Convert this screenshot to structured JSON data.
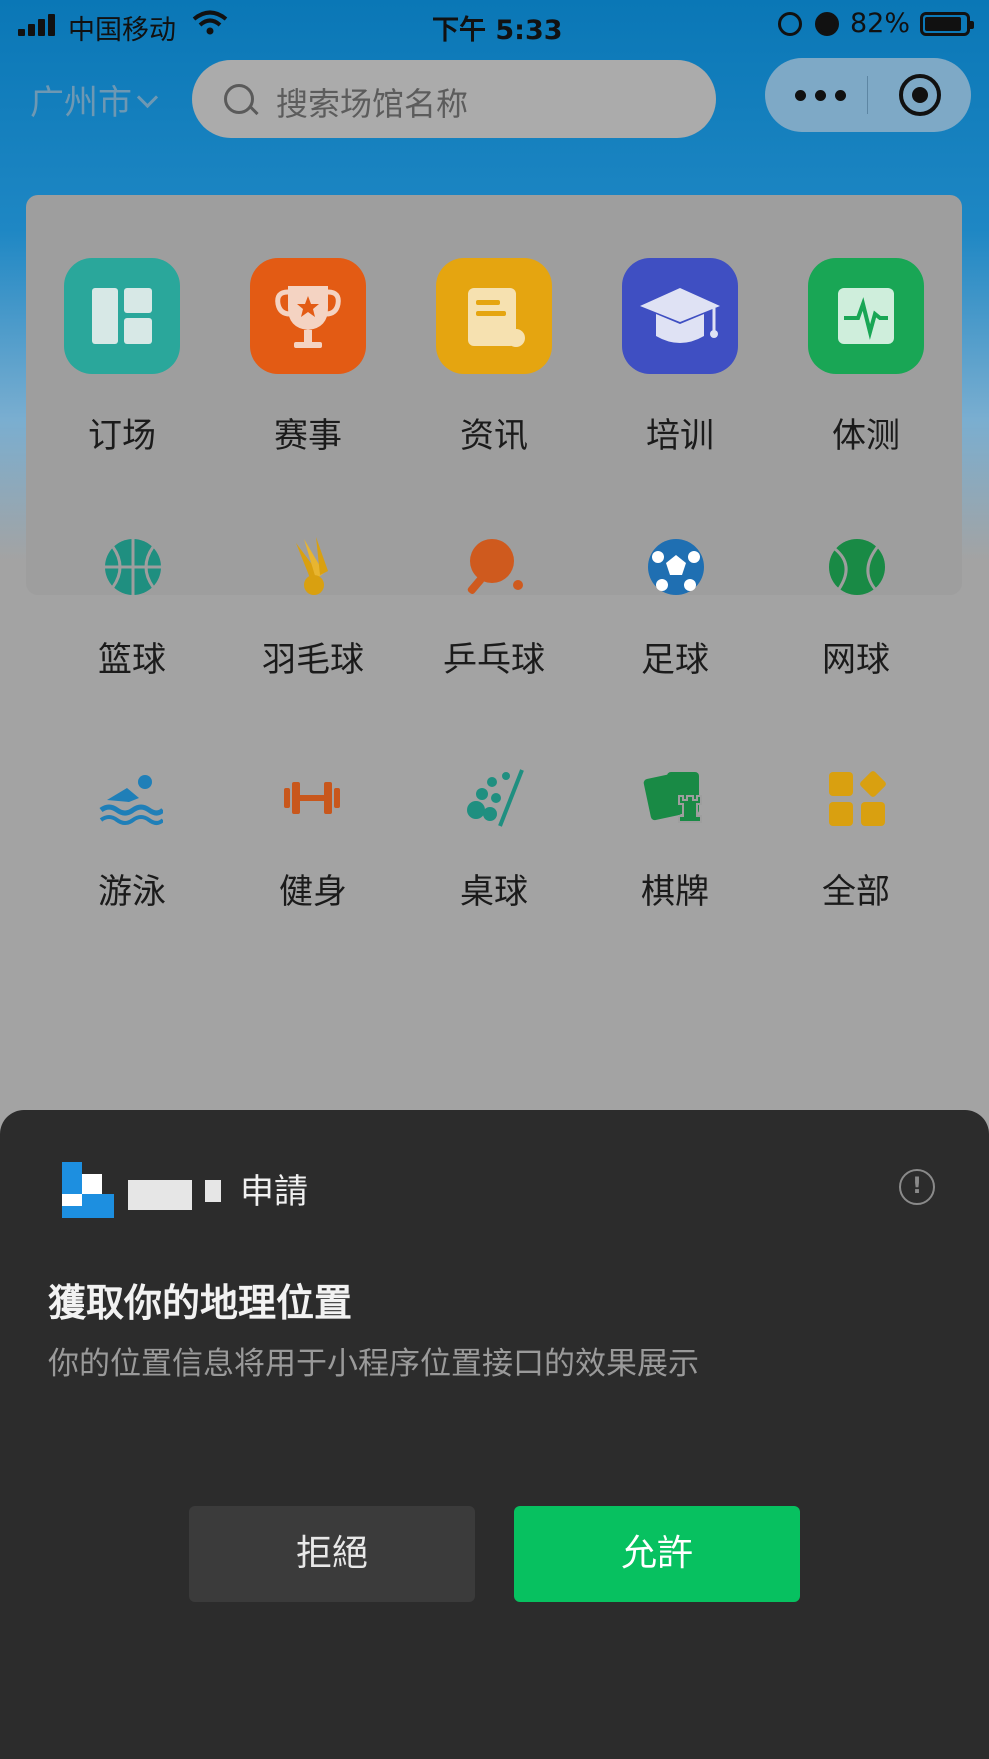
{
  "status_bar": {
    "carrier": "中国移动",
    "time": "下午 5:33",
    "battery": "82%"
  },
  "header": {
    "city": "广州市",
    "search_placeholder": "搜索场馆名称"
  },
  "main_nav": [
    {
      "label": "订场",
      "icon": "venue-booking-icon",
      "color": "#2aa79b"
    },
    {
      "label": "赛事",
      "icon": "trophy-icon",
      "color": "#e35b14"
    },
    {
      "label": "资讯",
      "icon": "news-scroll-icon",
      "color": "#e5a510"
    },
    {
      "label": "培训",
      "icon": "graduation-cap-icon",
      "color": "#3f4fc2"
    },
    {
      "label": "体测",
      "icon": "fitness-test-icon",
      "color": "#19a655"
    }
  ],
  "sports_row1": [
    {
      "label": "篮球",
      "icon": "basketball-icon",
      "color": "#1f8f80"
    },
    {
      "label": "羽毛球",
      "icon": "badminton-icon",
      "color": "#d9a010"
    },
    {
      "label": "乒乓球",
      "icon": "table-tennis-icon",
      "color": "#cf5a1e"
    },
    {
      "label": "足球",
      "icon": "soccer-icon",
      "color": "#1f6fb2"
    },
    {
      "label": "网球",
      "icon": "tennis-icon",
      "color": "#198a45"
    }
  ],
  "sports_row2": [
    {
      "label": "游泳",
      "icon": "swimming-icon",
      "color": "#1f7fb8"
    },
    {
      "label": "健身",
      "icon": "dumbbell-icon",
      "color": "#c8571c"
    },
    {
      "label": "桌球",
      "icon": "billiards-icon",
      "color": "#1f8f80"
    },
    {
      "label": "棋牌",
      "icon": "cards-chess-icon",
      "color": "#198a45"
    },
    {
      "label": "全部",
      "icon": "all-grid-icon",
      "color": "#d9a010"
    }
  ],
  "permission_sheet": {
    "requester_suffix": "申請",
    "title": "獲取你的地理位置",
    "description": "你的位置信息将用于小程序位置接口的效果展示",
    "deny_label": "拒絕",
    "allow_label": "允許"
  }
}
